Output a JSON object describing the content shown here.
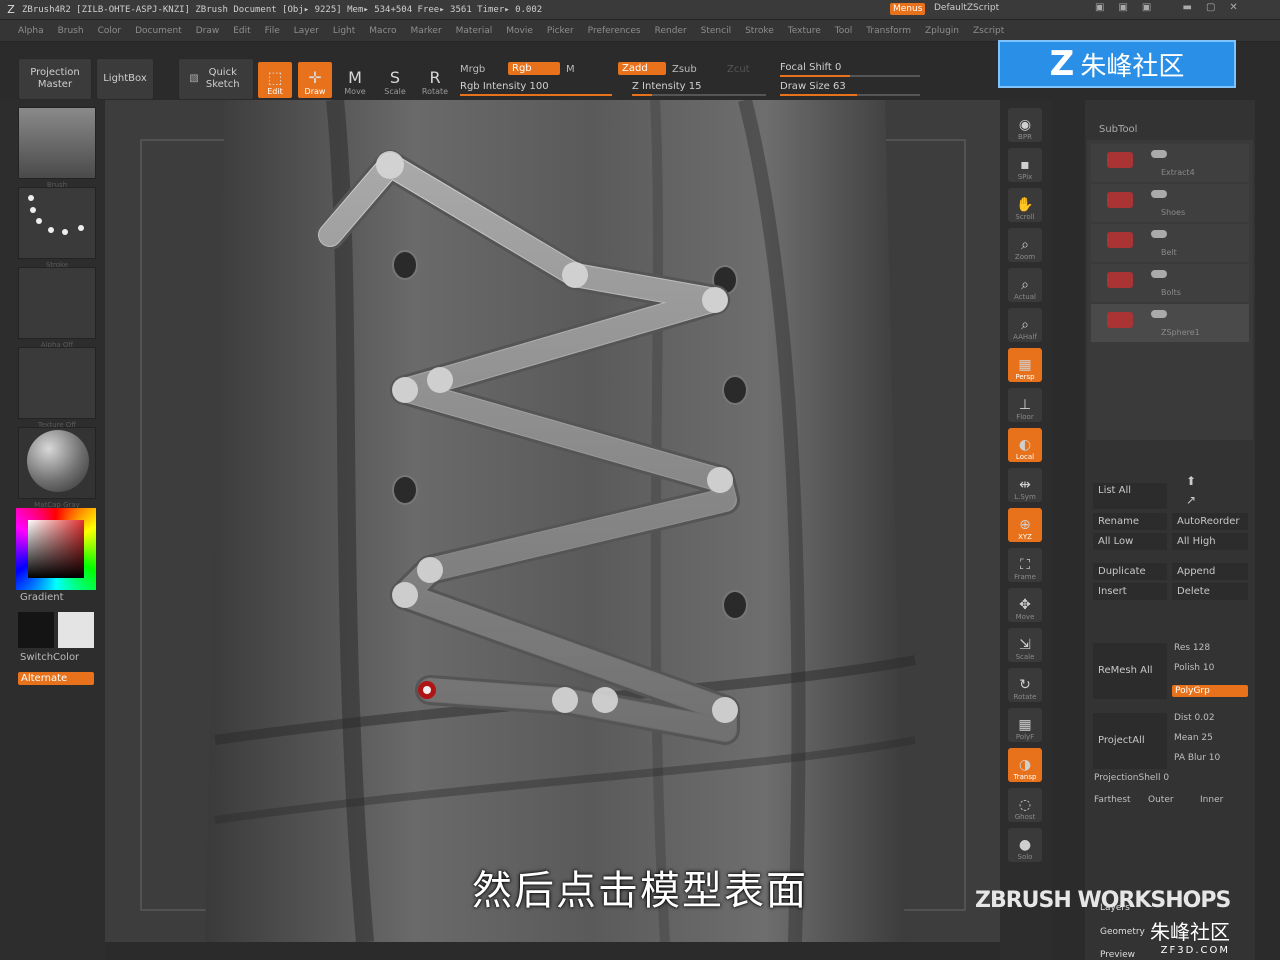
{
  "titlebar": {
    "text": "ZBrush4R2 [ZILB-OHTE-ASPJ-KNZI]   ZBrush Document   [Obj▸ 9225] Mem▸ 534+504 Free▸ 3561 Timer▸ 0.002",
    "menus_button": "Menus",
    "script_label": "DefaultZScript"
  },
  "menubar": {
    "items": [
      "Alpha",
      "Brush",
      "Color",
      "Document",
      "Draw",
      "Edit",
      "File",
      "Layer",
      "Light",
      "Macro",
      "Marker",
      "Material",
      "Movie",
      "Picker",
      "Preferences",
      "Render",
      "Stencil",
      "Stroke",
      "Texture",
      "Tool",
      "Transform",
      "Zplugin",
      "Zscript"
    ]
  },
  "top_toolbar": {
    "projection_master": "Projection Master",
    "lightbox": "LightBox",
    "quick_sketch": "Quick Sketch",
    "edit": "Edit",
    "draw": "Draw",
    "move": "Move",
    "scale": "Scale",
    "rotate": "Rotate",
    "mrgb": "Mrgb",
    "rgb": "Rgb",
    "m": "M",
    "rgb_intensity": "Rgb Intensity 100",
    "zadd": "Zadd",
    "zsub": "Zsub",
    "zcut": "Zcut",
    "z_intensity": "Z Intensity 15",
    "focal_shift": "Focal Shift 0",
    "draw_size": "Draw Size 63",
    "rgb_intensity_level": 1.0,
    "z_intensity_level": 0.15,
    "focal_shift_level": 0.5,
    "draw_size_level": 0.55
  },
  "left_panel": {
    "thumbs": [
      "Brush",
      "Stroke",
      "Alpha Off",
      "Texture Off",
      "MatCap Gray"
    ],
    "gradient": "Gradient",
    "switch_color": "SwitchColor",
    "alternate": "Alternate"
  },
  "right_shelf": {
    "items": [
      {
        "label": "BPR",
        "icon": "bpr-icon",
        "active": false
      },
      {
        "label": "SPix",
        "icon": "spix-icon",
        "active": false
      },
      {
        "label": "Scroll",
        "icon": "scroll-icon",
        "active": false
      },
      {
        "label": "Zoom",
        "icon": "zoom-icon",
        "active": false
      },
      {
        "label": "Actual",
        "icon": "actual-icon",
        "active": false
      },
      {
        "label": "AAHalf",
        "icon": "aahalf-icon",
        "active": false
      },
      {
        "label": "Persp",
        "icon": "persp-icon",
        "active": true
      },
      {
        "label": "Floor",
        "icon": "floor-icon",
        "active": false
      },
      {
        "label": "Local",
        "icon": "local-icon",
        "active": true
      },
      {
        "label": "L.Sym",
        "icon": "lsym-icon",
        "active": false
      },
      {
        "label": "XYZ",
        "icon": "xyz-icon",
        "active": true
      },
      {
        "label": "Frame",
        "icon": "frame-icon",
        "active": false
      },
      {
        "label": "Move",
        "icon": "move-icon",
        "active": false
      },
      {
        "label": "Scale",
        "icon": "scale-icon",
        "active": false
      },
      {
        "label": "Rotate",
        "icon": "rotate-icon",
        "active": false
      },
      {
        "label": "PolyF",
        "icon": "polyf-icon",
        "active": false
      },
      {
        "label": "Transp",
        "icon": "transp-icon",
        "active": true
      },
      {
        "label": "Ghost",
        "icon": "ghost-icon",
        "active": false
      },
      {
        "label": "Solo",
        "icon": "solo-icon",
        "active": false
      }
    ]
  },
  "right_panel": {
    "subtool_title": "SubTool",
    "subtools": [
      "Extract4",
      "Shoes",
      "Belt",
      "Bolts",
      "ZSphere1"
    ],
    "list_all": "List All",
    "rename": "Rename",
    "auto_reorder": "AutoReorder",
    "all_low": "All Low",
    "all_high": "All High",
    "duplicate": "Duplicate",
    "append": "Append",
    "insert": "Insert",
    "delete": "Delete",
    "remesh_all": "ReMesh All",
    "res": "Res 128",
    "polish": "Polish 10",
    "polygrp": "PolyGrp",
    "project_all": "ProjectAll",
    "dist": "Dist 0.02",
    "mean": "Mean 25",
    "pa_blur": "PA Blur 10",
    "projection_shell": "ProjectionShell 0",
    "farthest": "Farthest",
    "outer": "Outer",
    "inner": "Inner",
    "layers": "Layers",
    "geometry": "Geometry",
    "preview": "Preview"
  },
  "watermark": {
    "top": "朱峰社区",
    "bottom_cn": "朱峰社区",
    "bottom_url": "ZF3D.COM",
    "workshops": "ZBRUSH WORKSHOPS"
  },
  "caption": "然后点击模型表面",
  "colors": {
    "accent": "#e8721c",
    "panel": "#333333",
    "viewport_bg": "#3d3d3d"
  }
}
